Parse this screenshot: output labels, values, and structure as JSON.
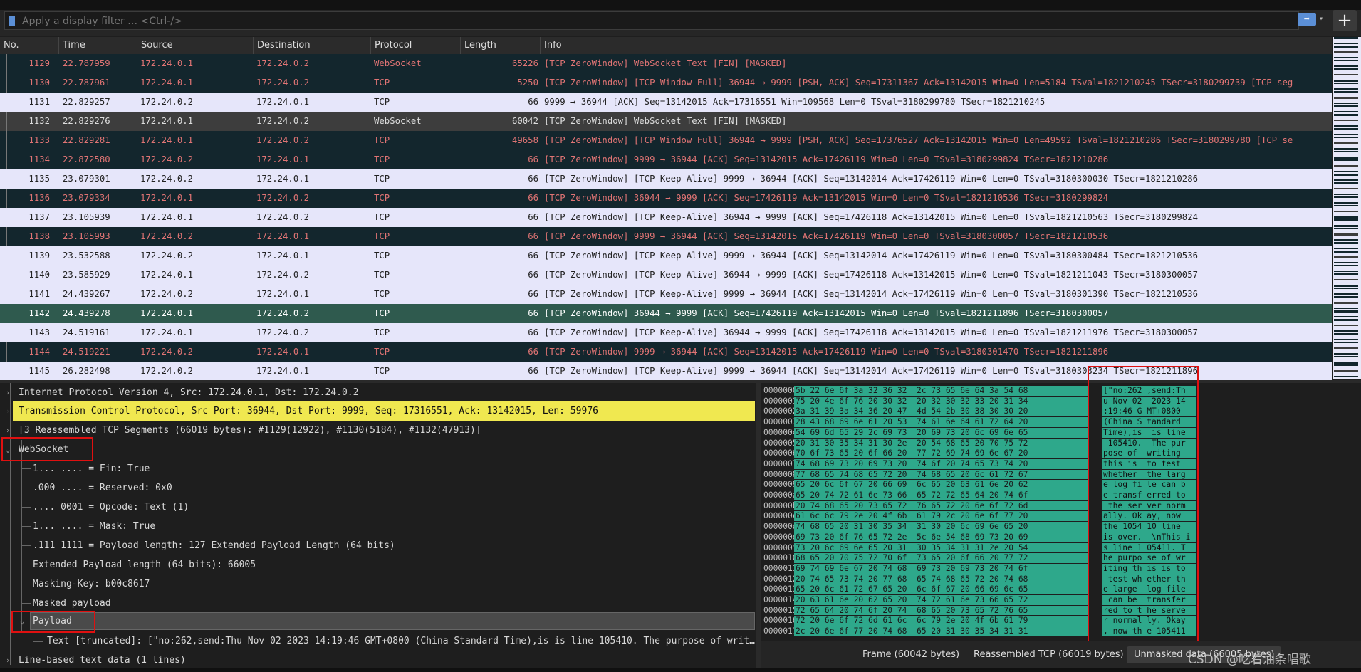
{
  "filter": {
    "placeholder": "Apply a display filter … <Ctrl-/>",
    "apply_label": "➡",
    "dropdown_label": "▾",
    "add_label": "+"
  },
  "columns": {
    "no": "No.",
    "time": "Time",
    "source": "Source",
    "destination": "Destination",
    "protocol": "Protocol",
    "length": "Length",
    "info": "Info"
  },
  "packets": [
    {
      "no": "1129",
      "time": "22.787959",
      "src": "172.24.0.1",
      "dst": "172.24.0.2",
      "proto": "WebSocket",
      "len": "65226",
      "info": "[TCP ZeroWindow] WebSocket Text [FIN] [MASKED]",
      "style": "bad"
    },
    {
      "no": "1130",
      "time": "22.787961",
      "src": "172.24.0.1",
      "dst": "172.24.0.2",
      "proto": "TCP",
      "len": "5250",
      "info": "[TCP ZeroWindow] [TCP Window Full] 36944 → 9999 [PSH, ACK] Seq=17311367 Ack=13142015 Win=0 Len=5184 TSval=1821210245 TSecr=3180299739 [TCP seg",
      "style": "bad"
    },
    {
      "no": "1131",
      "time": "22.829257",
      "src": "172.24.0.2",
      "dst": "172.24.0.1",
      "proto": "TCP",
      "len": "66",
      "info": "9999 → 36944 [ACK] Seq=13142015 Ack=17316551 Win=109568 Len=0 TSval=3180299780 TSecr=1821210245",
      "style": "ok"
    },
    {
      "no": "1132",
      "time": "22.829276",
      "src": "172.24.0.1",
      "dst": "172.24.0.2",
      "proto": "WebSocket",
      "len": "60042",
      "info": "[TCP ZeroWindow] WebSocket Text [FIN] [MASKED]",
      "style": "grey"
    },
    {
      "no": "1133",
      "time": "22.829281",
      "src": "172.24.0.1",
      "dst": "172.24.0.2",
      "proto": "TCP",
      "len": "49658",
      "info": "[TCP ZeroWindow] [TCP Window Full] 36944 → 9999 [PSH, ACK] Seq=17376527 Ack=13142015 Win=0 Len=49592 TSval=1821210286 TSecr=3180299780 [TCP se",
      "style": "bad"
    },
    {
      "no": "1134",
      "time": "22.872580",
      "src": "172.24.0.2",
      "dst": "172.24.0.1",
      "proto": "TCP",
      "len": "66",
      "info": "[TCP ZeroWindow] 9999 → 36944 [ACK] Seq=13142015 Ack=17426119 Win=0 Len=0 TSval=3180299824 TSecr=1821210286",
      "style": "bad"
    },
    {
      "no": "1135",
      "time": "23.079301",
      "src": "172.24.0.2",
      "dst": "172.24.0.1",
      "proto": "TCP",
      "len": "66",
      "info": "[TCP ZeroWindow] [TCP Keep-Alive] 9999 → 36944 [ACK] Seq=13142014 Ack=17426119 Win=0 Len=0 TSval=3180300030 TSecr=1821210286",
      "style": "ok"
    },
    {
      "no": "1136",
      "time": "23.079334",
      "src": "172.24.0.1",
      "dst": "172.24.0.2",
      "proto": "TCP",
      "len": "66",
      "info": "[TCP ZeroWindow] 36944 → 9999 [ACK] Seq=17426119 Ack=13142015 Win=0 Len=0 TSval=1821210536 TSecr=3180299824",
      "style": "bad"
    },
    {
      "no": "1137",
      "time": "23.105939",
      "src": "172.24.0.1",
      "dst": "172.24.0.2",
      "proto": "TCP",
      "len": "66",
      "info": "[TCP ZeroWindow] [TCP Keep-Alive] 36944 → 9999 [ACK] Seq=17426118 Ack=13142015 Win=0 Len=0 TSval=1821210563 TSecr=3180299824",
      "style": "ok"
    },
    {
      "no": "1138",
      "time": "23.105993",
      "src": "172.24.0.2",
      "dst": "172.24.0.1",
      "proto": "TCP",
      "len": "66",
      "info": "[TCP ZeroWindow] 9999 → 36944 [ACK] Seq=13142015 Ack=17426119 Win=0 Len=0 TSval=3180300057 TSecr=1821210536",
      "style": "bad"
    },
    {
      "no": "1139",
      "time": "23.532588",
      "src": "172.24.0.2",
      "dst": "172.24.0.1",
      "proto": "TCP",
      "len": "66",
      "info": "[TCP ZeroWindow] [TCP Keep-Alive] 9999 → 36944 [ACK] Seq=13142014 Ack=17426119 Win=0 Len=0 TSval=3180300484 TSecr=1821210536",
      "style": "ok"
    },
    {
      "no": "1140",
      "time": "23.585929",
      "src": "172.24.0.1",
      "dst": "172.24.0.2",
      "proto": "TCP",
      "len": "66",
      "info": "[TCP ZeroWindow] [TCP Keep-Alive] 36944 → 9999 [ACK] Seq=17426118 Ack=13142015 Win=0 Len=0 TSval=1821211043 TSecr=3180300057",
      "style": "ok"
    },
    {
      "no": "1141",
      "time": "24.439267",
      "src": "172.24.0.2",
      "dst": "172.24.0.1",
      "proto": "TCP",
      "len": "66",
      "info": "[TCP ZeroWindow] [TCP Keep-Alive] 9999 → 36944 [ACK] Seq=13142014 Ack=17426119 Win=0 Len=0 TSval=3180301390 TSecr=1821210536",
      "style": "ok"
    },
    {
      "no": "1142",
      "time": "24.439278",
      "src": "172.24.0.1",
      "dst": "172.24.0.2",
      "proto": "TCP",
      "len": "66",
      "info": "[TCP ZeroWindow] 36944 → 9999 [ACK] Seq=17426119 Ack=13142015 Win=0 Len=0 TSval=1821211896 TSecr=3180300057",
      "style": "sel"
    },
    {
      "no": "1143",
      "time": "24.519161",
      "src": "172.24.0.1",
      "dst": "172.24.0.2",
      "proto": "TCP",
      "len": "66",
      "info": "[TCP ZeroWindow] [TCP Keep-Alive] 36944 → 9999 [ACK] Seq=17426118 Ack=13142015 Win=0 Len=0 TSval=1821211976 TSecr=3180300057",
      "style": "ok"
    },
    {
      "no": "1144",
      "time": "24.519221",
      "src": "172.24.0.2",
      "dst": "172.24.0.1",
      "proto": "TCP",
      "len": "66",
      "info": "[TCP ZeroWindow] 9999 → 36944 [ACK] Seq=13142015 Ack=17426119 Win=0 Len=0 TSval=3180301470 TSecr=1821211896",
      "style": "bad"
    },
    {
      "no": "1145",
      "time": "26.282498",
      "src": "172.24.0.2",
      "dst": "172.24.0.1",
      "proto": "TCP",
      "len": "66",
      "info": "[TCP ZeroWindow] [TCP Keep-Alive] 9999 → 36944 [ACK] Seq=13142014 Ack=17426119 Win=0 Len=0 TSval=3180303234 TSecr=1821211896",
      "style": "ok"
    }
  ],
  "detail": {
    "ip": "Internet Protocol Version 4, Src: 172.24.0.1, Dst: 172.24.0.2",
    "tcp": "Transmission Control Protocol, Src Port: 36944, Dst Port: 9999, Seq: 17316551, Ack: 13142015, Len: 59976",
    "reassembled": "[3 Reassembled TCP Segments (66019 bytes): #1129(12922), #1130(5184), #1132(47913)]",
    "websocket": "WebSocket",
    "fin": "1... .... = Fin: True",
    "reserved": ".000 .... = Reserved: 0x0",
    "opcode": ".... 0001 = Opcode: Text (1)",
    "mask": "1... .... = Mask: True",
    "payload_len": ".111 1111 = Payload length: 127 Extended Payload Length (64 bits)",
    "ext_payload_len": "Extended Payload length (64 bits): 66005",
    "masking_key": "Masking-Key: b00c8617",
    "masked_payload": "Masked payload",
    "payload": "Payload",
    "text": "Text [truncated]: [\"no:262,send:Thu Nov 02 2023 14:19:46 GMT+0800 (China Standard Time),is is line 105410. The purpose of writ…",
    "line_based": "Line-based text data (1 lines)"
  },
  "hex": [
    {
      "off": "00000000",
      "bytes": "5b 22 6e 6f 3a 32 36 32  2c 73 65 6e 64 3a 54 68",
      "ascii": "[\"no:262 ,send:Th"
    },
    {
      "off": "00000010",
      "bytes": "75 20 4e 6f 76 20 30 32  20 32 30 32 33 20 31 34",
      "ascii": "u Nov 02  2023 14"
    },
    {
      "off": "00000020",
      "bytes": "3a 31 39 3a 34 36 20 47  4d 54 2b 30 38 30 30 20",
      "ascii": ":19:46 G MT+0800 "
    },
    {
      "off": "00000030",
      "bytes": "28 43 68 69 6e 61 20 53  74 61 6e 64 61 72 64 20",
      "ascii": "(China S tandard "
    },
    {
      "off": "00000040",
      "bytes": "54 69 6d 65 29 2c 69 73  20 69 73 20 6c 69 6e 65",
      "ascii": "Time),is  is line"
    },
    {
      "off": "00000050",
      "bytes": "20 31 30 35 34 31 30 2e  20 54 68 65 20 70 75 72",
      "ascii": " 105410.  The pur"
    },
    {
      "off": "00000060",
      "bytes": "70 6f 73 65 20 6f 66 20  77 72 69 74 69 6e 67 20",
      "ascii": "pose of  writing "
    },
    {
      "off": "00000070",
      "bytes": "74 68 69 73 20 69 73 20  74 6f 20 74 65 73 74 20",
      "ascii": "this is  to test "
    },
    {
      "off": "00000080",
      "bytes": "77 68 65 74 68 65 72 20  74 68 65 20 6c 61 72 67",
      "ascii": "whether  the larg"
    },
    {
      "off": "00000090",
      "bytes": "65 20 6c 6f 67 20 66 69  6c 65 20 63 61 6e 20 62",
      "ascii": "e log fi le can b"
    },
    {
      "off": "000000a0",
      "bytes": "65 20 74 72 61 6e 73 66  65 72 72 65 64 20 74 6f",
      "ascii": "e transf erred to"
    },
    {
      "off": "000000b0",
      "bytes": "20 74 68 65 20 73 65 72  76 65 72 20 6e 6f 72 6d",
      "ascii": " the ser ver norm"
    },
    {
      "off": "000000c0",
      "bytes": "61 6c 6c 79 2e 20 4f 6b  61 79 2c 20 6e 6f 77 20",
      "ascii": "ally. Ok ay, now "
    },
    {
      "off": "000000d0",
      "bytes": "74 68 65 20 31 30 35 34  31 30 20 6c 69 6e 65 20",
      "ascii": "the 1054 10 line "
    },
    {
      "off": "000000e0",
      "bytes": "69 73 20 6f 76 65 72 2e  5c 6e 54 68 69 73 20 69",
      "ascii": "is over.  \\nThis i"
    },
    {
      "off": "000000f0",
      "bytes": "73 20 6c 69 6e 65 20 31  30 35 34 31 31 2e 20 54",
      "ascii": "s line 1 05411. T"
    },
    {
      "off": "00000100",
      "bytes": "68 65 20 70 75 72 70 6f  73 65 20 6f 66 20 77 72",
      "ascii": "he purpo se of wr"
    },
    {
      "off": "00000110",
      "bytes": "69 74 69 6e 67 20 74 68  69 73 20 69 73 20 74 6f",
      "ascii": "iting th is is to"
    },
    {
      "off": "00000120",
      "bytes": "20 74 65 73 74 20 77 68  65 74 68 65 72 20 74 68",
      "ascii": " test wh ether th"
    },
    {
      "off": "00000130",
      "bytes": "65 20 6c 61 72 67 65 20  6c 6f 67 20 66 69 6c 65",
      "ascii": "e large  log file"
    },
    {
      "off": "00000140",
      "bytes": "20 63 61 6e 20 62 65 20  74 72 61 6e 73 66 65 72",
      "ascii": " can be  transfer"
    },
    {
      "off": "00000150",
      "bytes": "72 65 64 20 74 6f 20 74  68 65 20 73 65 72 76 65",
      "ascii": "red to t he serve"
    },
    {
      "off": "00000160",
      "bytes": "72 20 6e 6f 72 6d 61 6c  6c 79 2e 20 4f 6b 61 79",
      "ascii": "r normal ly. Okay"
    },
    {
      "off": "00000170",
      "bytes": "2c 20 6e 6f 77 20 74 68  65 20 31 30 35 34 31 31",
      "ascii": ", now th e 105411"
    }
  ],
  "hex_tabs": {
    "frame": "Frame (60042 bytes)",
    "reassembled": "Reassembled TCP (66019 bytes)",
    "unmasked": "Unmasked data (66005 bytes)"
  },
  "watermark": "CSDN @吃着油条唱歌",
  "colors": {
    "bad_bg": "#13262d",
    "bad_fg": "#e07474",
    "ok_bg": "#e6e6fa",
    "selected_bg": "#2f5a4e",
    "highlight": "#f0e850",
    "hex_highlight": "#2ea88b",
    "annotation_box": "#e01010"
  }
}
